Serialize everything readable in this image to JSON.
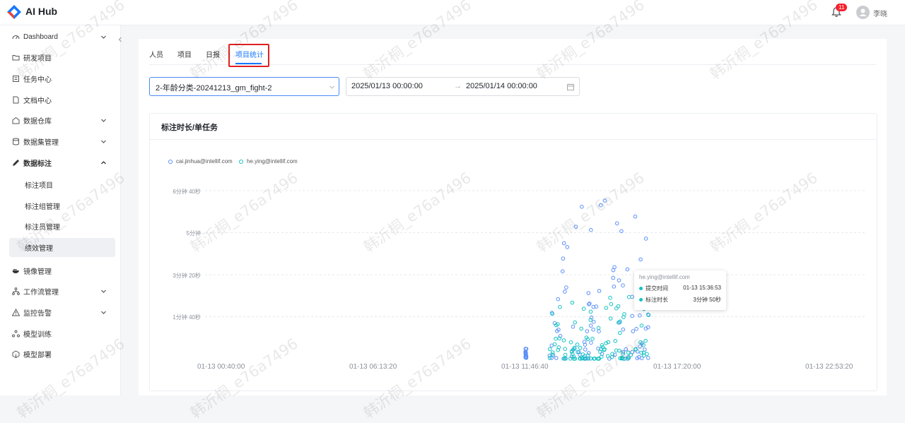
{
  "app": {
    "title": "AI Hub"
  },
  "header": {
    "notification_count": "11",
    "user_name": "李晓"
  },
  "sidebar": {
    "items": [
      {
        "label": "Dashboard",
        "icon": "dashboard-icon",
        "expandable": true
      },
      {
        "label": "研发项目",
        "icon": "folder-icon"
      },
      {
        "label": "任务中心",
        "icon": "task-icon"
      },
      {
        "label": "文档中心",
        "icon": "document-icon"
      },
      {
        "label": "数据仓库",
        "icon": "warehouse-icon",
        "expandable": true
      },
      {
        "label": "数据集管理",
        "icon": "database-icon",
        "expandable": true
      },
      {
        "label": "数据标注",
        "icon": "annotation-icon",
        "expanded": true
      },
      {
        "label": "镜像管理",
        "icon": "docker-icon"
      },
      {
        "label": "工作流管理",
        "icon": "workflow-icon",
        "expandable": true
      },
      {
        "label": "监控告警",
        "icon": "alert-icon",
        "expandable": true
      },
      {
        "label": "模型训练",
        "icon": "training-icon"
      },
      {
        "label": "模型部署",
        "icon": "deploy-icon"
      }
    ],
    "sub_items": [
      {
        "label": "标注项目"
      },
      {
        "label": "标注组管理"
      },
      {
        "label": "标注员管理"
      },
      {
        "label": "绩效管理",
        "active": true
      }
    ]
  },
  "tabs": [
    {
      "label": "人员"
    },
    {
      "label": "项目"
    },
    {
      "label": "日报"
    },
    {
      "label": "项目统计",
      "active": true
    }
  ],
  "filters": {
    "project_select": "2-年龄分类-20241213_gm_fight-2",
    "date_start": "2025/01/13 00:00:00",
    "date_separator": "→",
    "date_end": "2025/01/14 00:00:00"
  },
  "chart_title": "标注时长/单任务",
  "chart_data": {
    "type": "scatter",
    "title": "标注时长/单任务",
    "legend_position": "top-left",
    "grid": "horizontal-dashed",
    "series": [
      {
        "name": "cai.jinhua@intellif.com",
        "color": "#5b8ff9"
      },
      {
        "name": "he.ying@intellif.com",
        "color": "#13c2c2"
      }
    ],
    "x_ticks": [
      "01-13 00:40:00",
      "01-13 06:13:20",
      "01-13 11:46:40",
      "01-13 17:20:00",
      "01-13 22:53:20"
    ],
    "y_ticks": [
      "6分钟 40秒",
      "5分钟",
      "3分钟 20秒",
      "1分钟 40秒"
    ],
    "y_unit": "seconds",
    "y_range": [
      0,
      400
    ],
    "x_range": [
      "01-13 00:40:00",
      "01-14 00:00:00"
    ],
    "clusters": [
      {
        "series": "cai.jinhua@intellif.com",
        "x_range": [
          "01-13 11:46:40",
          "01-13 11:53:00"
        ],
        "y_range": [
          0,
          40
        ],
        "approx_points": 20
      },
      {
        "series": "cai.jinhua@intellif.com",
        "x_range": [
          "01-13 12:40:00",
          "01-13 16:20:00"
        ],
        "y_range": [
          0,
          400
        ],
        "approx_points": 90
      },
      {
        "series": "he.ying@intellif.com",
        "x_range": [
          "01-13 12:40:00",
          "01-13 16:20:00"
        ],
        "y_range": [
          0,
          160
        ],
        "approx_points": 110
      }
    ]
  },
  "tooltip": {
    "title": "he.ying@intellif.com",
    "rows": [
      {
        "label": "提交时间",
        "value": "01-13 15:36:53"
      },
      {
        "label": "标注时长",
        "value": "3分钟 50秒"
      }
    ]
  },
  "watermark": "韩沂桐_e76a7496",
  "colors": {
    "primary": "#1677ff",
    "series1": "#5b8ff9",
    "series2": "#13c2c2",
    "highlight": "#e02020"
  }
}
